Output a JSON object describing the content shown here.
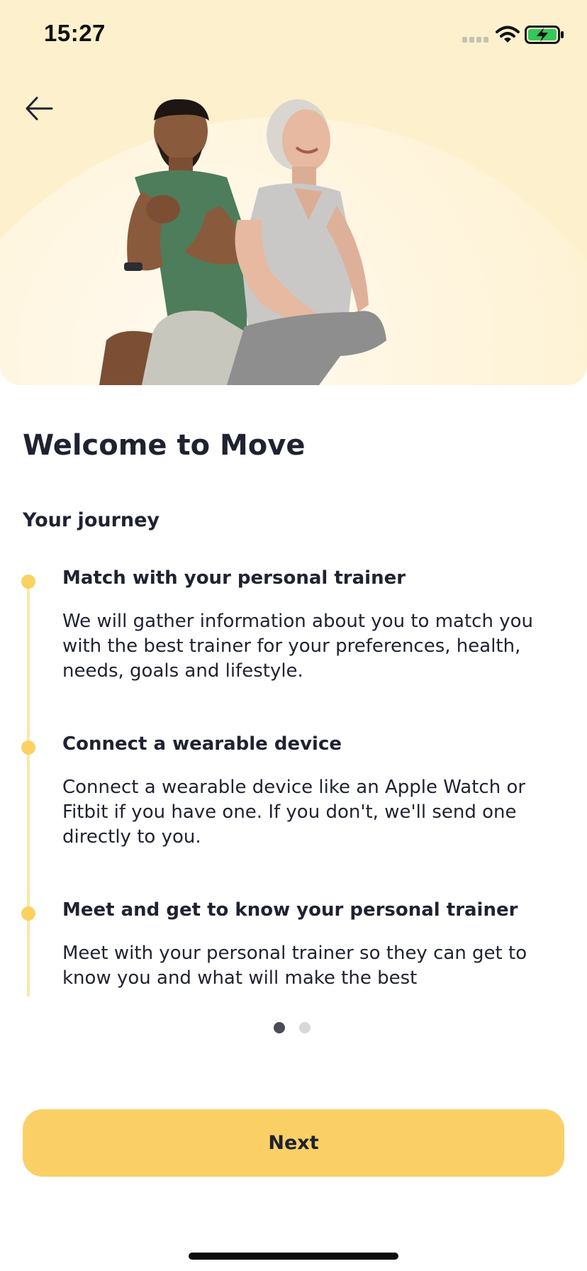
{
  "status_bar": {
    "time": "15:27",
    "icons": [
      "signal-icon",
      "wifi-icon",
      "battery-charging-icon"
    ]
  },
  "hero": {
    "back_icon": "arrow-left-icon",
    "image": "trainer-and-senior-stretching-photo"
  },
  "title": "Welcome to Move",
  "section_title": "Your journey",
  "steps": [
    {
      "title": "Match with your personal trainer",
      "description": "We will gather information about you to match you with the best trainer for your preferences, health, needs, goals and lifestyle."
    },
    {
      "title": "Connect a wearable device",
      "description": "Connect a wearable device like an Apple Watch or Fitbit if you have one. If you don't, we'll send one directly to you."
    },
    {
      "title": "Meet and get to know your personal trainer",
      "description": "Meet with your personal trainer so they can get to know you and what will make the best"
    }
  ],
  "pager": {
    "current": 1,
    "total": 2
  },
  "next_button": "Next",
  "colors": {
    "hero_bg": "#fdf0cc",
    "accent": "#fad066",
    "timeline_dot": "#fbd260",
    "timeline_line": "#fbe7a9",
    "text": "#1f2230",
    "pager_active": "#4a4c56",
    "pager_inactive": "#d7d7d9"
  }
}
